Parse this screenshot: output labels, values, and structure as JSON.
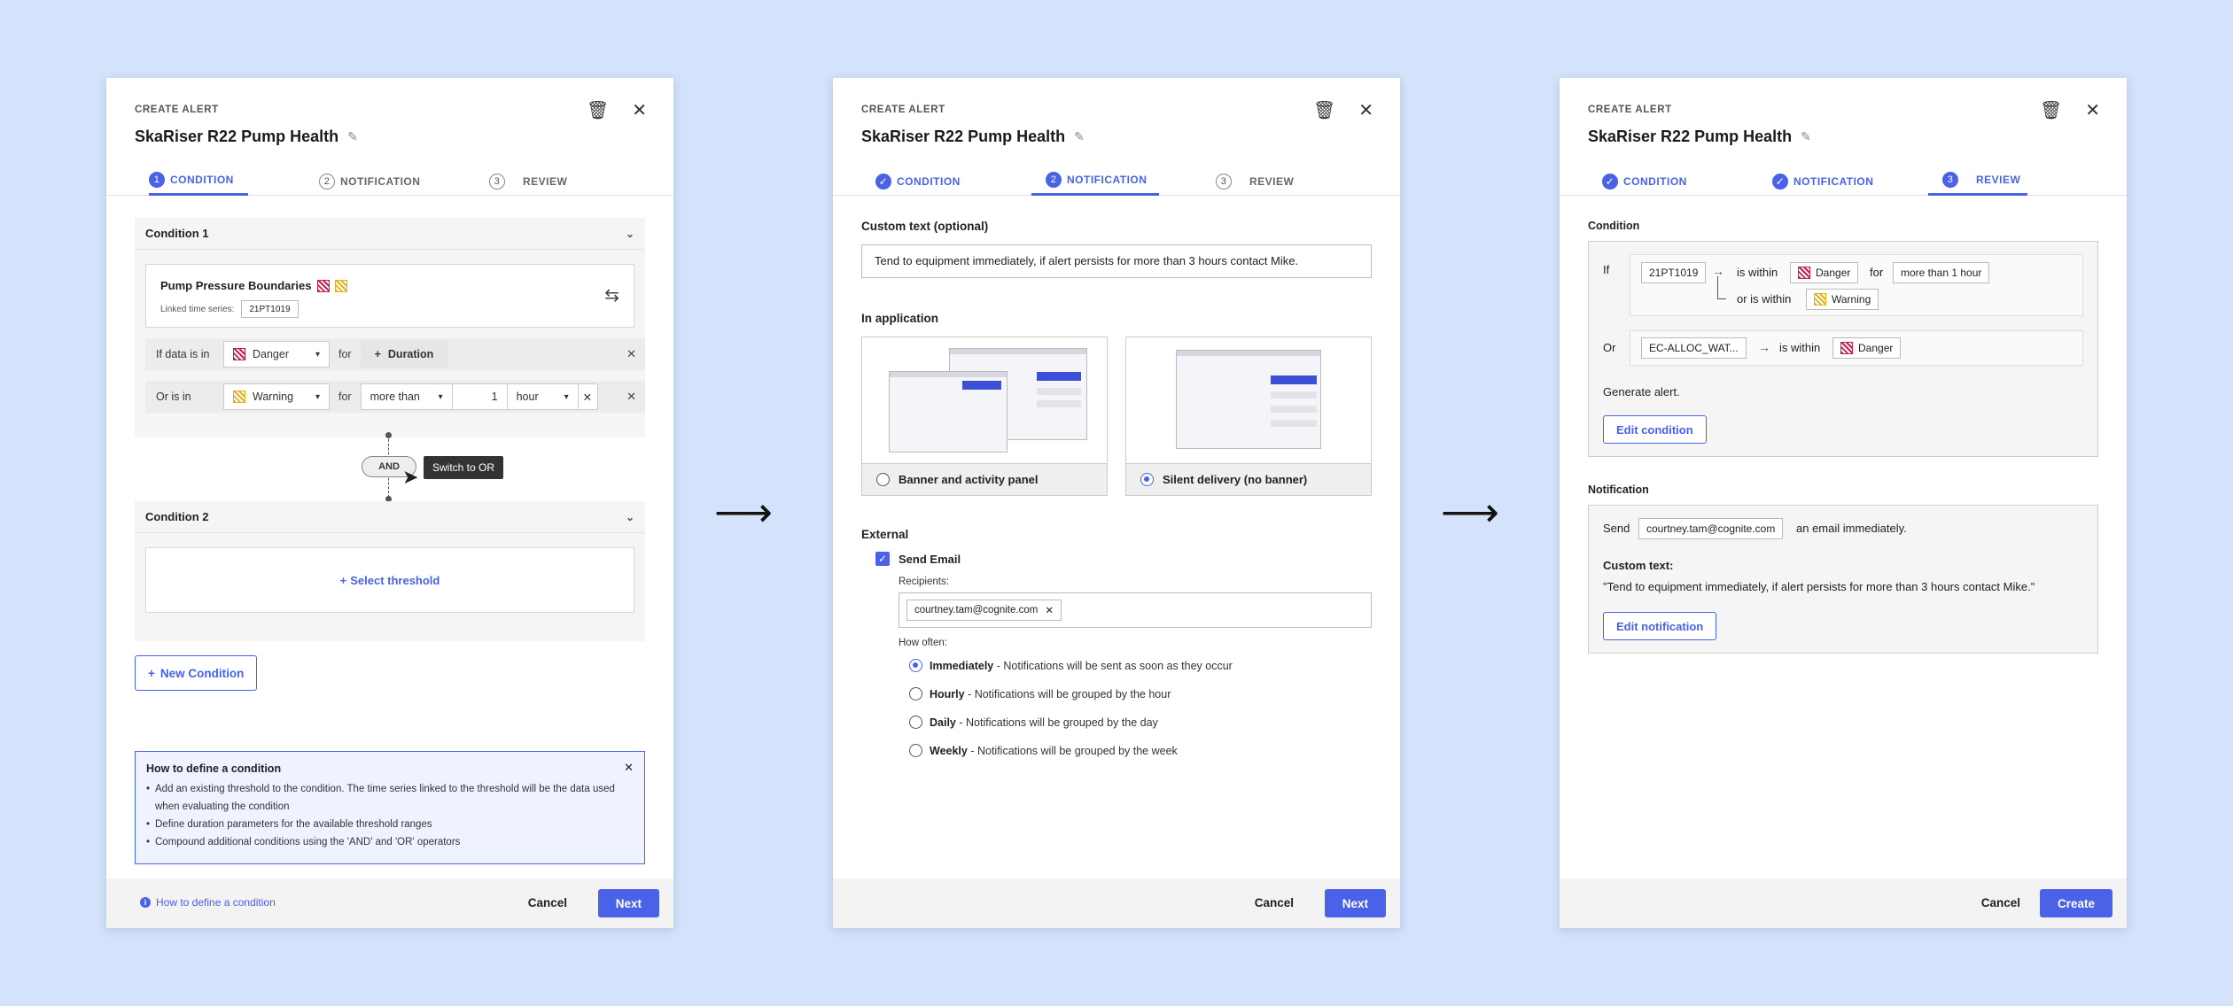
{
  "common": {
    "eyebrow": "CREATE ALERT",
    "title": "SkaRiser R22 Pump Health",
    "cancel": "Cancel",
    "tabs": [
      {
        "num": "1",
        "label": "CONDITION"
      },
      {
        "num": "2",
        "label": "NOTIFICATION"
      },
      {
        "num": "3",
        "label": "REVIEW"
      }
    ]
  },
  "panel1": {
    "condition1": {
      "header": "Condition 1",
      "threshold_name": "Pump Pressure Boundaries",
      "linked_label": "Linked time series:",
      "linked_value": "21PT1019",
      "row1": {
        "label": "If data is in",
        "select": "Danger",
        "for": "for",
        "duration_btn": "Duration"
      },
      "row2": {
        "label": "Or is in",
        "select": "Warning",
        "for": "for",
        "op": "more than",
        "num": "1",
        "unit": "hour"
      }
    },
    "operator": "AND",
    "tooltip": "Switch to OR",
    "condition2": {
      "header": "Condition 2",
      "select_threshold": "Select threshold"
    },
    "new_condition": "New Condition",
    "howto": {
      "title": "How to define a condition",
      "items": [
        "Add an existing threshold to the condition. The time series linked to the threshold will be the data used when evaluating the condition",
        "Define duration parameters for the available threshold ranges",
        "Compound additional conditions using the 'AND' and 'OR' operators"
      ]
    },
    "help_link": "How to define a condition",
    "next": "Next"
  },
  "panel2": {
    "custom_label": "Custom text (optional)",
    "custom_text": "Tend to equipment immediately, if alert persists for more than 3 hours contact Mike.",
    "in_app_label": "In application",
    "opt_banner": "Banner and activity panel",
    "opt_silent": "Silent delivery (no banner)",
    "external_label": "External",
    "send_email": "Send Email",
    "recipients_label": "Recipients:",
    "recipient": "courtney.tam@cognite.com",
    "how_often": "How often:",
    "freq": [
      {
        "name": "Immediately",
        "desc": " - Notifications will be sent as soon as they occur"
      },
      {
        "name": "Hourly",
        "desc": " - Notifications will be grouped by the hour"
      },
      {
        "name": "Daily",
        "desc": " - Notifications will be grouped by the day"
      },
      {
        "name": "Weekly",
        "desc": " - Notifications will be grouped by the week"
      }
    ],
    "next": "Next"
  },
  "panel3": {
    "condition_label": "Condition",
    "if": "If",
    "ts1": "21PT1019",
    "is_within": "is within",
    "danger": "Danger",
    "for": "for",
    "duration": "more than 1 hour",
    "or_is_within": "or is within",
    "warning": "Warning",
    "or": "Or",
    "ts2": "EC-ALLOC_WAT...",
    "generate": "Generate alert.",
    "edit_condition": "Edit condition",
    "notification_label": "Notification",
    "send": "Send",
    "email": "courtney.tam@cognite.com",
    "email_suffix": "an email immediately.",
    "custom_label": "Custom text:",
    "custom_text": "\"Tend to equipment immediately, if alert persists for more than 3 hours contact Mike.\"",
    "edit_notification": "Edit notification",
    "create": "Create"
  },
  "colors": {
    "accent": "#4a62e8",
    "danger": "#c5214e",
    "warning": "#e3b11c",
    "background": "#d4e2fb"
  },
  "icons": [
    "trash-icon",
    "close-icon",
    "pencil-icon",
    "chevron-down-icon",
    "swap-icon",
    "plus-icon",
    "info-icon",
    "check-icon",
    "arrow-right-icon",
    "cursor-icon"
  ]
}
